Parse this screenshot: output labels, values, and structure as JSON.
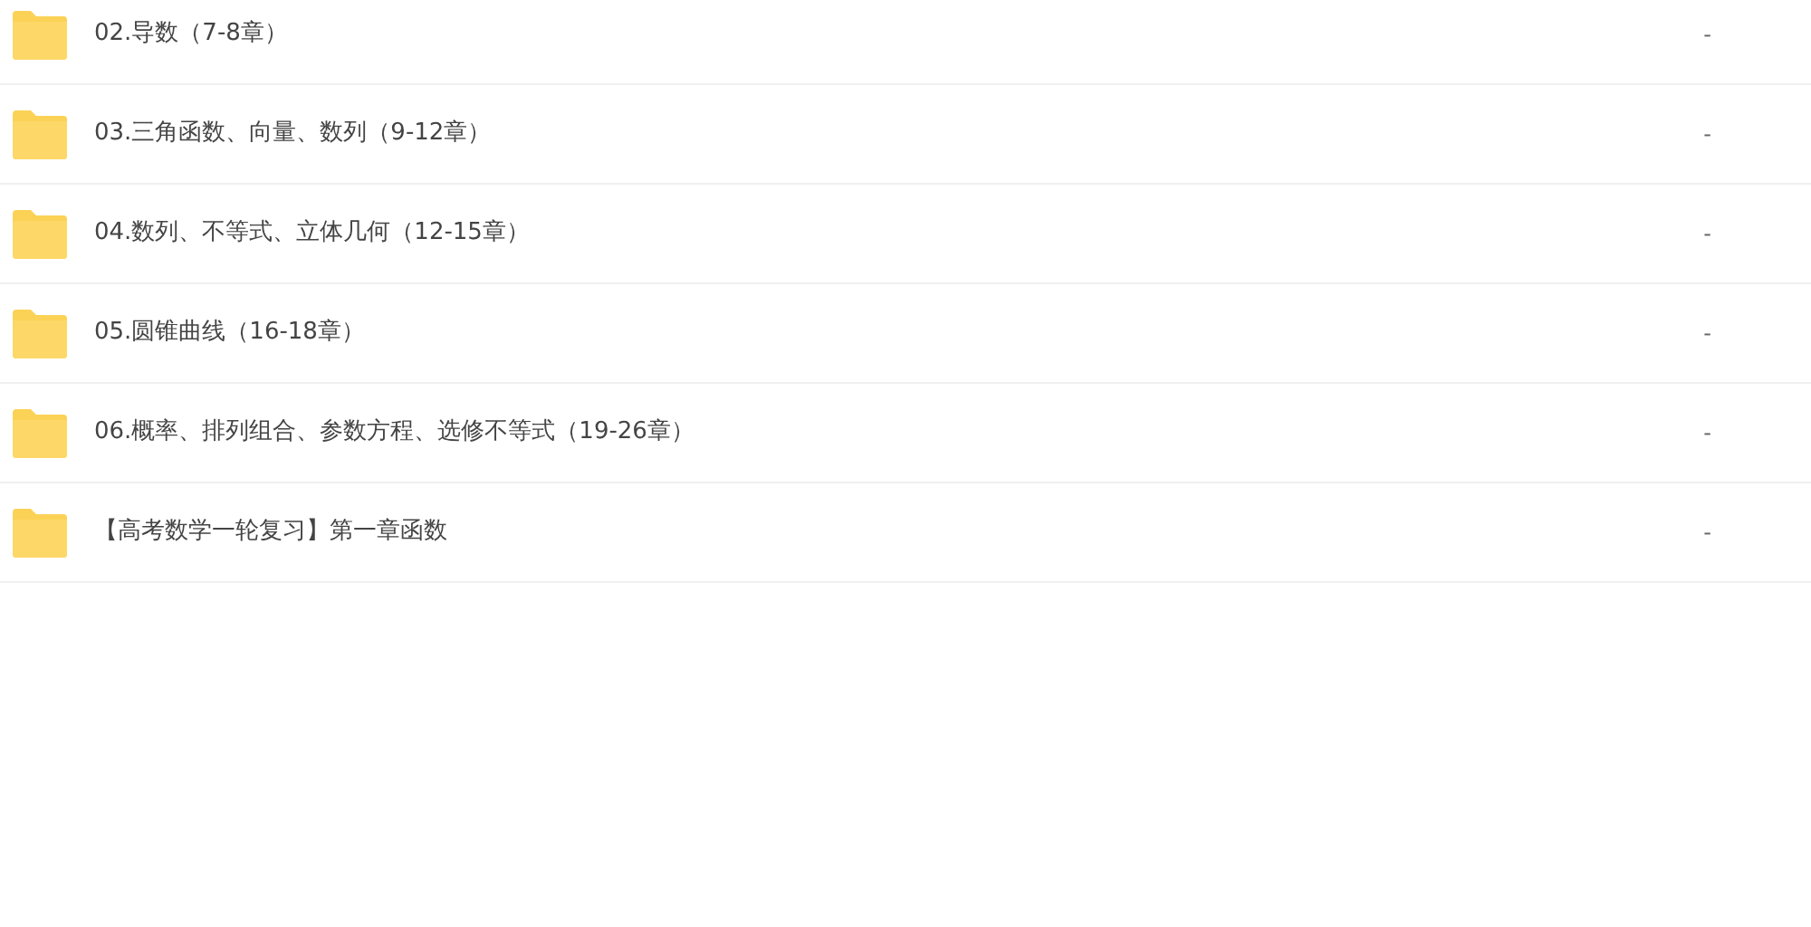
{
  "files": [
    {
      "name": "02.导数（7-8章）",
      "size": "-"
    },
    {
      "name": "03.三角函数、向量、数列（9-12章）",
      "size": "-"
    },
    {
      "name": "04.数列、不等式、立体几何（12-15章）",
      "size": "-"
    },
    {
      "name": "05.圆锥曲线（16-18章）",
      "size": "-"
    },
    {
      "name": "06.概率、排列组合、参数方程、选修不等式（19-26章）",
      "size": "-"
    },
    {
      "name": "【高考数学一轮复习】第一章函数",
      "size": "-"
    }
  ]
}
